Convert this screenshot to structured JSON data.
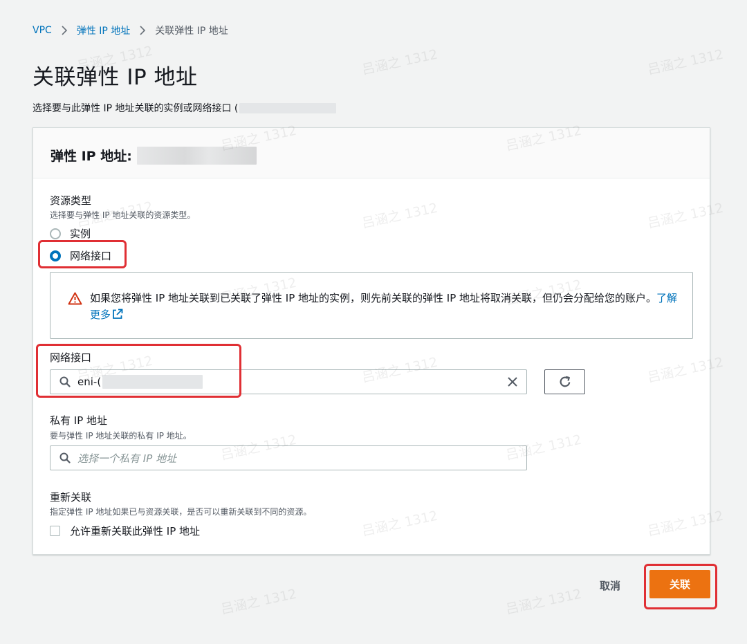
{
  "breadcrumb": {
    "items": [
      "VPC",
      "弹性 IP 地址"
    ],
    "current": "关联弹性 IP 地址"
  },
  "page": {
    "title": "关联弹性 IP 地址",
    "description": "选择要与此弹性 IP 地址关联的实例或网络接口 ("
  },
  "panel": {
    "header_title": "弹性 IP 地址:",
    "resource_type": {
      "label": "资源类型",
      "description": "选择要与弹性 IP 地址关联的资源类型。",
      "options": [
        "实例",
        "网络接口"
      ],
      "selected": "网络接口"
    },
    "alert": {
      "text": "如果您将弹性 IP 地址关联到已关联了弹性 IP 地址的实例，则先前关联的弹性 IP 地址将取消关联，但仍会分配给您的账户。",
      "link": "了解更多"
    },
    "network_interface": {
      "label": "网络接口",
      "value": "eni-("
    },
    "private_ip": {
      "label": "私有 IP 地址",
      "description": "要与弹性 IP 地址关联的私有 IP 地址。",
      "placeholder": "选择一个私有 IP 地址"
    },
    "reassociation": {
      "label": "重新关联",
      "description": "指定弹性 IP 地址如果已与资源关联，是否可以重新关联到不同的资源。",
      "checkbox_label": "允许重新关联此弹性 IP 地址"
    }
  },
  "footer": {
    "cancel": "取消",
    "submit": "关联"
  },
  "watermark": "吕涵之 1312",
  "colors": {
    "link": "#0073bb",
    "primary": "#ec7211",
    "highlight": "#e02f34",
    "warning": "#d13212"
  }
}
